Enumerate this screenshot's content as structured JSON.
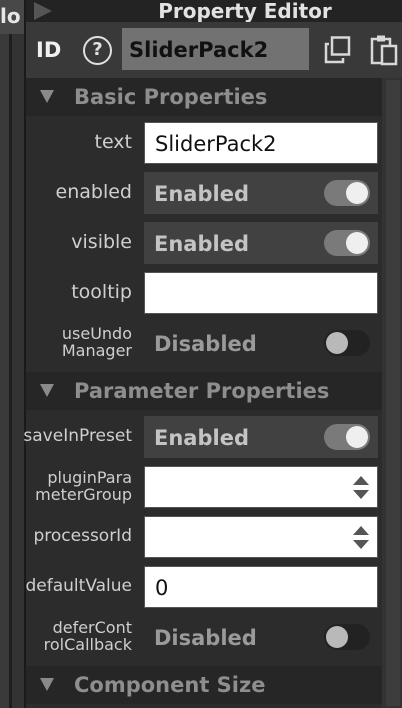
{
  "left_window": {
    "title_fragment": "lo"
  },
  "editor": {
    "title": "Property Editor",
    "id_label": "ID",
    "id_value": "SliderPack2",
    "help_glyph": "?",
    "icons": [
      "help-icon",
      "copy-icon",
      "paste-icon",
      "play-icon",
      "collapse-triangle-icon"
    ]
  },
  "sections": {
    "basic": "Basic Properties",
    "parameter": "Parameter Properties",
    "size": "Component Size"
  },
  "properties": {
    "text": {
      "label": "text",
      "value": "SliderPack2"
    },
    "enabled": {
      "label": "enabled",
      "value": "Enabled",
      "on": true
    },
    "visible": {
      "label": "visible",
      "value": "Enabled",
      "on": true
    },
    "tooltip": {
      "label": "tooltip",
      "value": ""
    },
    "useUndoManager": {
      "label_1": "useUndo",
      "label_2": "Manager",
      "value": "Disabled",
      "on": false
    },
    "saveInPreset": {
      "label": "saveInPreset",
      "value": "Enabled",
      "on": true
    },
    "pluginParameterGroup": {
      "label_1": "pluginPara",
      "label_2": "meterGroup",
      "value": ""
    },
    "processorId": {
      "label": "processorId",
      "value": ""
    },
    "defaultValue": {
      "label": "defaultValue",
      "value": "0"
    },
    "deferControlCallback": {
      "label_1": "deferCont",
      "label_2": "rolCallback",
      "value": "Disabled",
      "on": false
    }
  },
  "colors": {
    "panel_bg": "#2c2c2c",
    "section_bg": "#262626",
    "toggle_on_bg": "#414141",
    "field_bg": "#ffffff"
  }
}
